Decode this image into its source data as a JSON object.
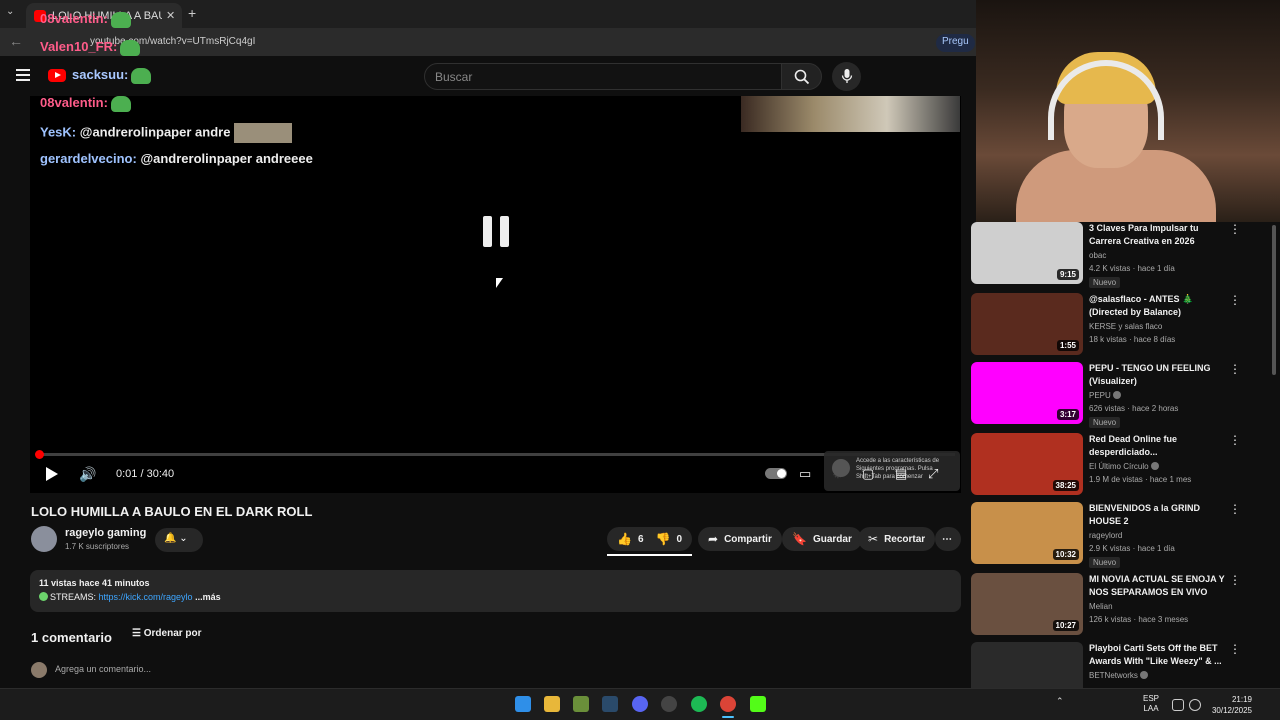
{
  "browser": {
    "tab_title": "LOLO HUMILLA A BAULO",
    "url": "youtube.com/watch?v=UTmsRjCq4gI",
    "ask_label": "Pregu"
  },
  "masthead": {
    "search_placeholder": "Buscar"
  },
  "chat": [
    {
      "user": "08valentin:",
      "text": "",
      "emote": true
    },
    {
      "user": "Valen10_FR:",
      "text": "",
      "emote": true
    },
    {
      "user": "sacksuu:",
      "text": "",
      "emote": true
    },
    {
      "user": "08valentin:",
      "text": "",
      "emote": true
    },
    {
      "user": "YesK:",
      "text": "@andrerolinpaper andre",
      "emote": false
    },
    {
      "user": "gerardelvecino:",
      "text": "@andrerolinpaper andreeee",
      "emote": false
    }
  ],
  "player": {
    "time": "0:01 / 30:40",
    "progress_fraction": 0.001,
    "tooltip": "Accede a las características de Siguientes programas. Pulsa Shift+Tab para comenzar"
  },
  "video": {
    "title": "LOLO HUMILLA A BAULO EN EL DARK ROLL",
    "channel": "rageylo gaming",
    "subscribers": "1.7 K suscriptores",
    "likes": "6",
    "dislikes": "0",
    "share_label": "Compartir",
    "save_label": "Guardar",
    "clip_label": "Recortar",
    "more_icon": "⋯",
    "views_time": "11 vistas  hace 41 minutos",
    "desc_prefix": "STREAMS: ",
    "desc_link": "https://kick.com/rageylo",
    "desc_more": " ...más",
    "comments_count": "1 comentario",
    "sort_label": "Ordenar por",
    "add_comment": "Agrega un comentario..."
  },
  "recommendations": [
    {
      "title": "3 Claves Para Impulsar tu Carrera Creativa en 2026",
      "channel": "obac",
      "verified": false,
      "stats": "4.2 K vistas · hace 1 día",
      "nuevo": "Nuevo",
      "duration": "9:15",
      "thumb": "#cfcfcf"
    },
    {
      "title": "@salasflaco  - ANTES 🎄 (Directed by Balance)",
      "channel": "KERSE y salas flaco",
      "verified": false,
      "stats": "18 k vistas · hace 8 días",
      "nuevo": "",
      "duration": "1:55",
      "thumb": "#5a2a1e"
    },
    {
      "title": "PEPU - TENGO UN FEELING (Visualizer)",
      "channel": "PEPU",
      "verified": true,
      "stats": "626 vistas · hace 2 horas",
      "nuevo": "Nuevo",
      "duration": "3:17",
      "thumb": "#ff00ff"
    },
    {
      "title": "Red Dead Online fue desperdiciado...",
      "channel": "El Último Círculo",
      "verified": true,
      "stats": "1.9 M de vistas · hace 1 mes",
      "nuevo": "",
      "duration": "38:25",
      "thumb": "#b03020"
    },
    {
      "title": "BIENVENIDOS a la GRIND HOUSE 2",
      "channel": "rageylord",
      "verified": false,
      "stats": "2.9 K vistas · hace 1 día",
      "nuevo": "Nuevo",
      "duration": "10:32",
      "thumb": "#c8904a"
    },
    {
      "title": "MI NOVIA ACTUAL SE ENOJA Y NOS SEPARAMOS EN VIVO",
      "channel": "Melian",
      "verified": false,
      "stats": "126 k vistas · hace 3 meses",
      "nuevo": "",
      "duration": "10:27",
      "thumb": "#6a5040"
    },
    {
      "title": "Playboi Carti Sets Off the BET Awards With \"Like Weezy\" & ...",
      "channel": "BETNetworks",
      "verified": true,
      "stats": "",
      "nuevo": "",
      "duration": "",
      "thumb": "#2a2a2a"
    }
  ],
  "taskbar": {
    "lang_1": "ESP",
    "lang_2": "LAA",
    "time": "21:19",
    "date": "30/12/2025",
    "tray_icons": "⌃"
  },
  "colors": {
    "accent_red": "#ff0000",
    "link_blue": "#3ea6ff",
    "chat_name": "#ff5c8a"
  }
}
